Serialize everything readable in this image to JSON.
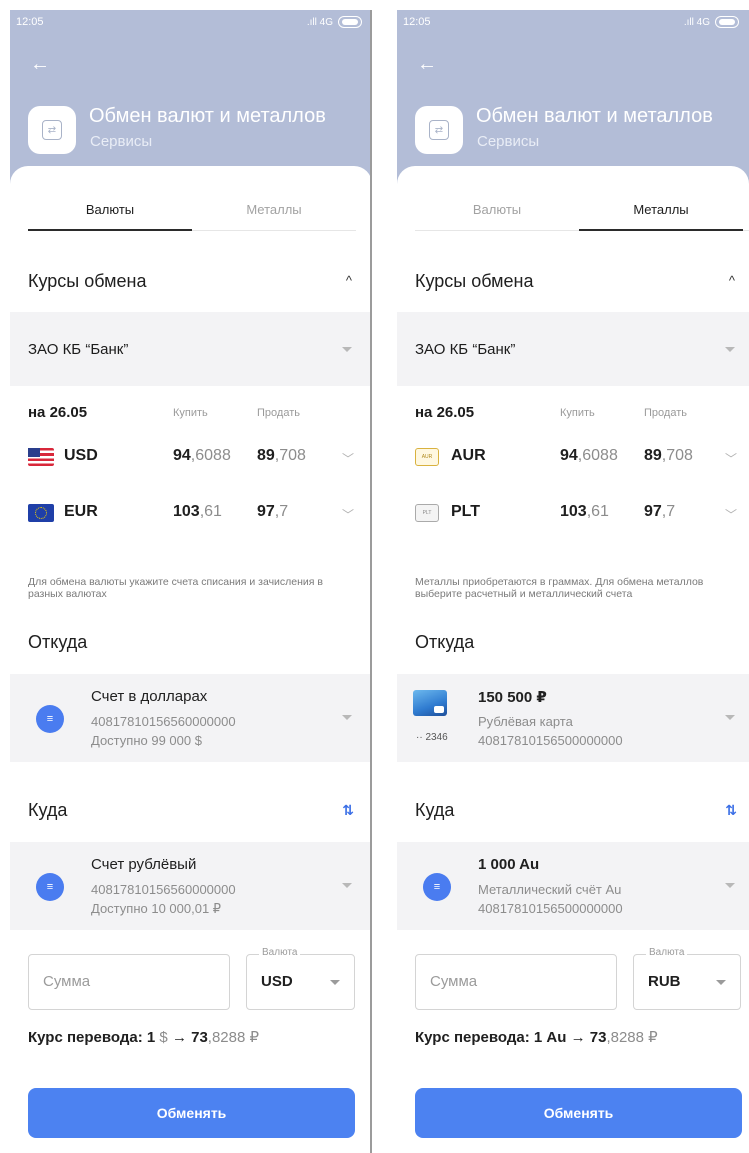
{
  "status": {
    "time": "12:05",
    "network": ".ıll 4G"
  },
  "header": {
    "back_icon": "←",
    "title": "Обмен валют и металлов",
    "subtitle": "Сервисы",
    "service_icon_glyph": "⇄"
  },
  "tabs": [
    "Валюты",
    "Металлы"
  ],
  "rates": {
    "section_title": "Курсы обмена",
    "collapse_icon": "^",
    "bank": "ЗАО КБ “Банк”",
    "date": "на 26.05",
    "buy_label": "Купить",
    "sell_label": "Продать",
    "row_chevron": "﹀"
  },
  "screens": [
    {
      "active_tab": "Валюты",
      "rows": [
        {
          "icon": "us-flag-icon",
          "code": "USD",
          "buy_int": "94",
          "buy_frac": ",6088",
          "sell_int": "89",
          "sell_frac": ",708"
        },
        {
          "icon": "eu-flag-icon",
          "code": "EUR",
          "buy_int": "103",
          "buy_frac": ",61",
          "sell_int": "97",
          "sell_frac": ",7"
        }
      ],
      "note": "Для обмена валюты укажите счета списания и зачисления в разных валютах",
      "from": {
        "section": "Откуда",
        "title": "Счет в долларах",
        "line1": "40817810156560000000",
        "line2": "Доступно 99 000 $"
      },
      "to": {
        "section": "Куда",
        "title": "Счет рублёвый",
        "line1": "40817810156560000000",
        "line2": "Доступно 10 000,01 ₽"
      },
      "amount_placeholder": "Сумма",
      "currency_label": "Валюта",
      "currency_value": "USD",
      "rate": {
        "label": "Курс перевода: 1",
        "unit": "$",
        "arrow": "→",
        "int": "73",
        "frac": ",8288 ₽"
      },
      "button": "Обменять"
    },
    {
      "active_tab": "Металлы",
      "rows": [
        {
          "icon": "gold-bar-icon",
          "icon_text": "AUR",
          "code": "AUR",
          "buy_int": "94",
          "buy_frac": ",6088",
          "sell_int": "89",
          "sell_frac": ",708"
        },
        {
          "icon": "platinum-bar-icon",
          "icon_text": "PLT",
          "code": "PLT",
          "buy_int": "103",
          "buy_frac": ",61",
          "sell_int": "97",
          "sell_frac": ",7"
        }
      ],
      "note": "Металлы приобретаются в граммах. Для обмена металлов выберите расчетный и металлический счета",
      "from": {
        "section": "Откуда",
        "title": "150 500 ₽",
        "line1": "Рублёвая карта",
        "line2": "40817810156500000000",
        "card_number": "·· 2346"
      },
      "to": {
        "section": "Куда",
        "title": "1 000 Au",
        "line1": "Металлический счёт Au",
        "line2": "40817810156500000000"
      },
      "amount_placeholder": "Сумма",
      "currency_label": "Валюта",
      "currency_value": "RUB",
      "rate": {
        "label": "Курс перевода: 1 Au",
        "unit": "",
        "arrow": "→",
        "int": "73",
        "frac": ",8288 ₽"
      },
      "button": "Обменять"
    }
  ],
  "colors": {
    "header_bg": "#b3bdd7",
    "accent": "#4c82f1",
    "panel": "#f3f3f5"
  }
}
